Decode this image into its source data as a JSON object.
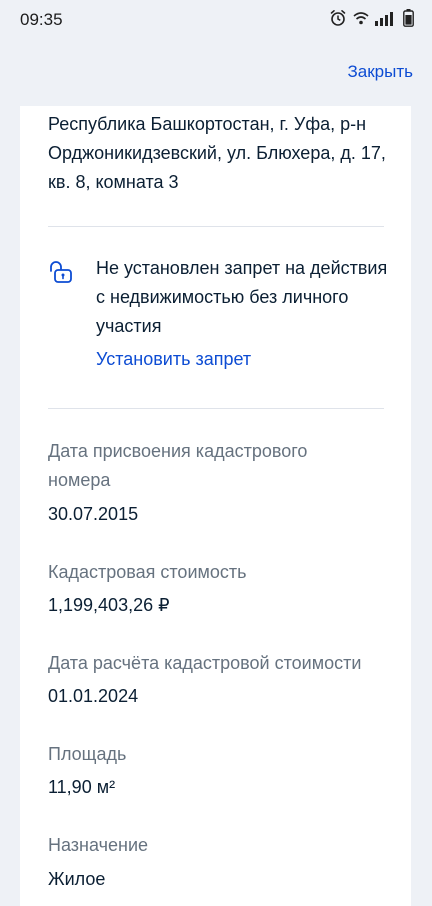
{
  "status_bar": {
    "time": "09:35"
  },
  "nav": {
    "close_label": "Закрыть"
  },
  "property": {
    "address": "Республика Башкортостан, г. Уфа, р-н Орджоникидзевский, ул. Блюхера, д. 17, кв. 8, комната 3",
    "ban_status": "Не установлен запрет на действия с недвижимостью без личного участия",
    "ban_link": "Установить запрет",
    "fields": [
      {
        "label": "Дата присвоения кадастрового номера",
        "value": "30.07.2015"
      },
      {
        "label": "Кадастровая стоимость",
        "value": "1,199,403,26 ₽"
      },
      {
        "label": "Дата расчёта кадастровой стоимости",
        "value": "01.01.2024"
      },
      {
        "label": "Площадь",
        "value": "11,90 м²"
      },
      {
        "label": "Назначение",
        "value": "Жилое"
      }
    ]
  },
  "colors": {
    "accent": "#0d4cd3",
    "background": "#eef1f6",
    "text": "#0b1f33",
    "muted": "#66727f"
  },
  "icons": [
    "alarm-icon",
    "wifi-icon",
    "signal-icon",
    "battery-icon",
    "lock-icon"
  ]
}
